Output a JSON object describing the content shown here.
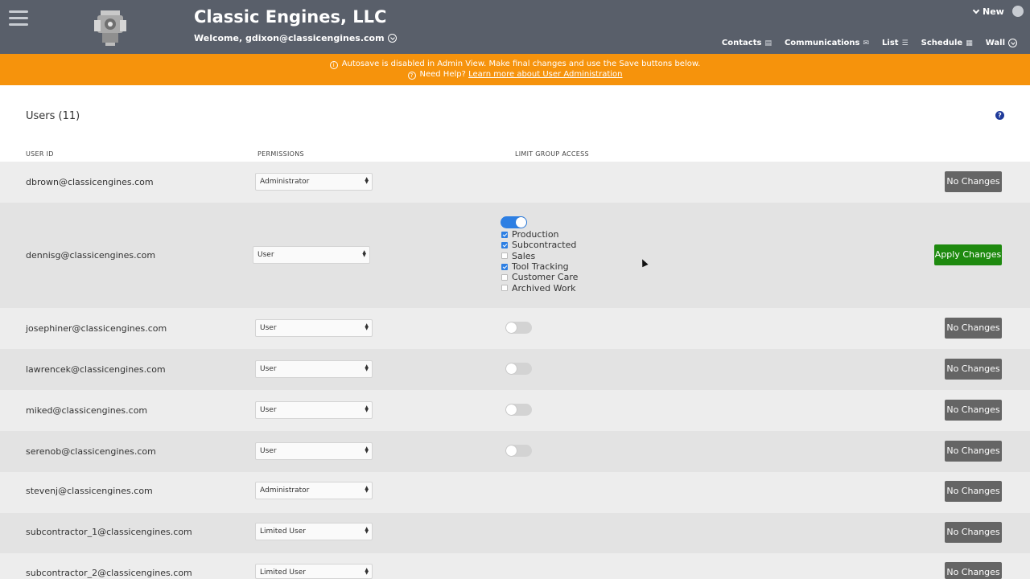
{
  "header": {
    "company": "Classic Engines, LLC",
    "welcome": "Welcome, gdixon@classicengines.com",
    "new_label": "New",
    "nav": [
      {
        "label": "Contacts",
        "icon": "contacts-card-icon"
      },
      {
        "label": "Communications",
        "icon": "envelope-icon"
      },
      {
        "label": "List",
        "icon": "list-icon"
      },
      {
        "label": "Schedule",
        "icon": "calendar-icon"
      },
      {
        "label": "Wall",
        "icon": "circle-chevron-icon"
      }
    ]
  },
  "banner": {
    "line1": "Autosave is disabled in Admin View. Make final changes and use the Save buttons below.",
    "help_prefix": "Need Help?",
    "help_link": "Learn more about User Administration",
    "color": "#f6930c"
  },
  "users_title": "Users (11)",
  "columns": {
    "user_id": "USER ID",
    "permissions": "PERMISSIONS",
    "limit_group_access": "LIMIT GROUP ACCESS"
  },
  "rows": [
    {
      "email": "dbrown@classicengines.com",
      "permission": "Administrator",
      "button": "No Changes"
    },
    {
      "email": "dennisg@classicengines.com",
      "permission": "User",
      "button": "Apply Changes",
      "limit_access": true,
      "groups": [
        {
          "label": "Production",
          "checked": true
        },
        {
          "label": "Subcontracted",
          "checked": true
        },
        {
          "label": "Sales",
          "checked": false
        },
        {
          "label": "Tool Tracking",
          "checked": true
        },
        {
          "label": "Customer Care",
          "checked": false
        },
        {
          "label": "Archived Work",
          "checked": false
        }
      ]
    },
    {
      "email": "josephiner@classicengines.com",
      "permission": "User",
      "button": "No Changes",
      "limit_access": false
    },
    {
      "email": "lawrencek@classicengines.com",
      "permission": "User",
      "button": "No Changes",
      "limit_access": false
    },
    {
      "email": "miked@classicengines.com",
      "permission": "User",
      "button": "No Changes",
      "limit_access": false
    },
    {
      "email": "serenob@classicengines.com",
      "permission": "User",
      "button": "No Changes",
      "limit_access": false
    },
    {
      "email": "stevenj@classicengines.com",
      "permission": "Administrator",
      "button": "No Changes"
    },
    {
      "email": "subcontractor_1@classicengines.com",
      "permission": "Limited User",
      "button": "No Changes"
    },
    {
      "email": "subcontractor_2@classicengines.com",
      "permission": "Limited User",
      "button": "No Changes"
    }
  ],
  "colors": {
    "header_bg": "#595f6a",
    "apply_button": "#1e8a0f",
    "no_changes_button": "#656565",
    "toggle_on": "#2d7fe3"
  }
}
